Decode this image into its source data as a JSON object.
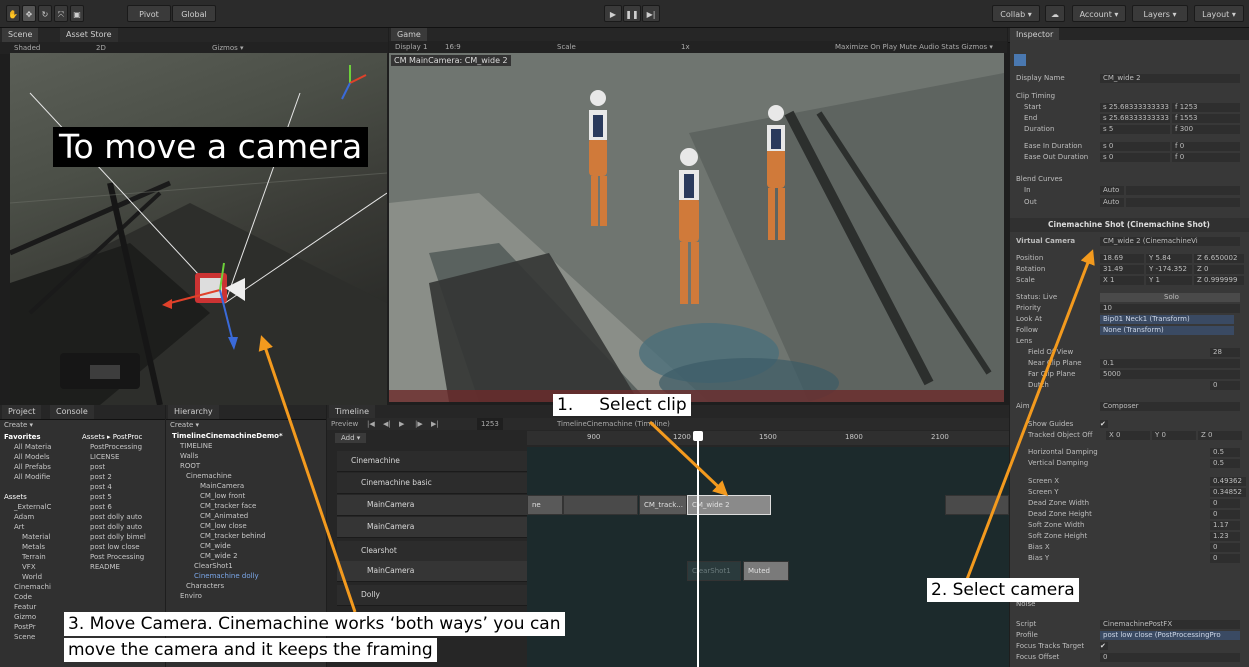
{
  "toolbar": {
    "pivot": "Pivot",
    "global": "Global",
    "collab": "Collab ▾",
    "account": "Account ▾",
    "layers": "Layers ▾",
    "layout": "Layout ▾"
  },
  "scene": {
    "tab_scene": "Scene",
    "tab_asset_store": "Asset Store",
    "shaded": "Shaded",
    "mode_2d": "2D",
    "gizmos": "Gizmos ▾"
  },
  "game": {
    "tab": "Game",
    "display": "Display 1",
    "aspect": "16:9",
    "scale_label": "Scale",
    "scale_value": "1x",
    "options": "Maximize On Play  Mute Audio  Stats  Gizmos ▾",
    "camera_label": "CM MainCamera: CM_wide 2"
  },
  "inspector": {
    "tab": "Inspector",
    "display_name_label": "Display Name",
    "display_name_value": "CM_wide 2",
    "clip_timing": "Clip Timing",
    "start_label": "Start",
    "start_s": "s 25.68333333333",
    "start_f": "f 1253",
    "end_label": "End",
    "end_s": "s 25.68333333333",
    "end_f": "f 1553",
    "duration_label": "Duration",
    "duration_s": "s 5",
    "duration_f": "f 300",
    "ease_in_label": "Ease In Duration",
    "ease_in_s": "s 0",
    "ease_in_f": "f 0",
    "ease_out_label": "Ease Out Duration",
    "ease_out_s": "s 0",
    "ease_out_f": "f 0",
    "blend_curves": "Blend Curves",
    "in_label": "In",
    "in_value": "Auto",
    "out_label": "Out",
    "out_value": "Auto",
    "component_title": "Cinemachine Shot (Cinemachine Shot)",
    "virtual_camera_label": "Virtual Camera",
    "virtual_camera_value": "CM_wide 2 (CinemachineVi",
    "position_label": "Position",
    "position_x": "18.69",
    "position_y": "Y 5.84",
    "position_z": "Z 6.650002",
    "rotation_label": "Rotation",
    "rotation_x": "31.49",
    "rotation_y": "Y -174.352",
    "rotation_z": "Z 0",
    "scale_label": "Scale",
    "scale_x": "X 1",
    "scale_y": "Y 1",
    "scale_z": "Z 0.999999",
    "status_label": "Status: Live",
    "status_value": "Solo",
    "priority_label": "Priority",
    "priority_value": "10",
    "look_at_label": "Look At",
    "look_at_value": "Bip01 Neck1 (Transform)",
    "follow_label": "Follow",
    "follow_value": "None (Transform)",
    "lens_label": "Lens",
    "fov_label": "Field Of View",
    "fov_value": "28",
    "near_label": "Near Clip Plane",
    "near_value": "0.1",
    "far_label": "Far Clip Plane",
    "far_value": "5000",
    "dutch_label": "Dutch",
    "dutch_value": "0",
    "aim_label": "Aim",
    "aim_value": "Composer",
    "show_guides_label": "Show Guides",
    "tracked_offset_label": "Tracked Object Off",
    "tracked_x": "X 0",
    "tracked_y": "Y 0",
    "tracked_z": "Z 0",
    "hdamp_label": "Horizontal Damping",
    "hdamp_value": "0.5",
    "vdamp_label": "Vertical Damping",
    "vdamp_value": "0.5",
    "screenx_label": "Screen X",
    "screenx_value": "0.49362",
    "screeny_label": "Screen Y",
    "screeny_value": "0.34852",
    "dzw_label": "Dead Zone Width",
    "dzw_value": "0",
    "dzh_label": "Dead Zone Height",
    "dzh_value": "0",
    "szw_label": "Soft Zone Width",
    "szw_value": "1.17",
    "szh_label": "Soft Zone Height",
    "szh_value": "1.23",
    "biasx_label": "Bias X",
    "biasx_value": "0",
    "biasy_label": "Bias Y",
    "biasy_value": "0",
    "noise_label": "Noise",
    "script_label": "Script",
    "script_value": "CinemachinePostFX",
    "profile_label": "Profile",
    "profile_value": "post low close (PostProcessingPro",
    "focus_tracks_label": "Focus Tracks Target",
    "focus_offset_label": "Focus Offset",
    "focus_offset_value": "0"
  },
  "project": {
    "tab_project": "Project",
    "tab_console": "Console",
    "create": "Create ▾",
    "favorites": "Favorites",
    "fav_items": [
      "All Materia",
      "All Models",
      "All Prefabs",
      "All Modifie"
    ],
    "assets_header": "Assets ▸ PostProc",
    "files": [
      "PostProcessing",
      "LICENSE",
      "post",
      "post 2",
      "post 4",
      "post 5",
      "post 6",
      "post dolly auto",
      "post dolly auto",
      "post dolly bimel",
      "post low close",
      "Post Processing",
      "README"
    ],
    "assets": "Assets",
    "asset_folders": [
      "_ExternalC",
      "Adam",
      "Art",
      "Material",
      "Metals",
      "Terrain",
      "VFX",
      "World",
      "Cinemachi",
      "Code",
      "Featur",
      "Gizmo",
      "PostPr",
      "Scene"
    ]
  },
  "hierarchy": {
    "tab": "Hierarchy",
    "create": "Create ▾",
    "scene_name": "TimelineCinemachineDemo*",
    "items": [
      "TIMELINE",
      "Walls",
      "ROOT",
      "Cinemachine",
      "MainCamera",
      "CM_low front",
      "CM_tracker face",
      "CM_Animated",
      "CM_low close",
      "CM_tracker behind",
      "CM_wide",
      "CM_wide 2",
      "ClearShot1",
      "Cinemachine dolly",
      "Characters",
      "Enviro"
    ]
  },
  "timeline": {
    "tab": "Timeline",
    "preview": "Preview",
    "frame": "1253",
    "add": "Add ▾",
    "title": "TimelineCinemachine (Timeline)",
    "ruler": [
      "900",
      "1200",
      "1500",
      "1800",
      "2100"
    ],
    "groups": [
      "Cinemachine",
      "Cinemachine basic",
      "Clearshot",
      "Dolly"
    ],
    "tracks": [
      "MainCamera",
      "MainCamera",
      "MainCamera"
    ],
    "clips": [
      "ne",
      "CM_track...",
      "CM_wide 2",
      "ClearShot1",
      "Muted"
    ]
  },
  "annotations": {
    "title": "To move a camera",
    "step1_num": "1.",
    "step1": "Select clip",
    "step2": "2. Select camera",
    "step3_line1": "3. Move Camera.  Cinemachine works ‘both ways’ you can",
    "step3_line2": "move the camera and it keeps the framing"
  },
  "colors": {
    "arrow": "#f39a1e",
    "playhead": "#ffffff",
    "selected_clip": "#8a8a8a"
  }
}
